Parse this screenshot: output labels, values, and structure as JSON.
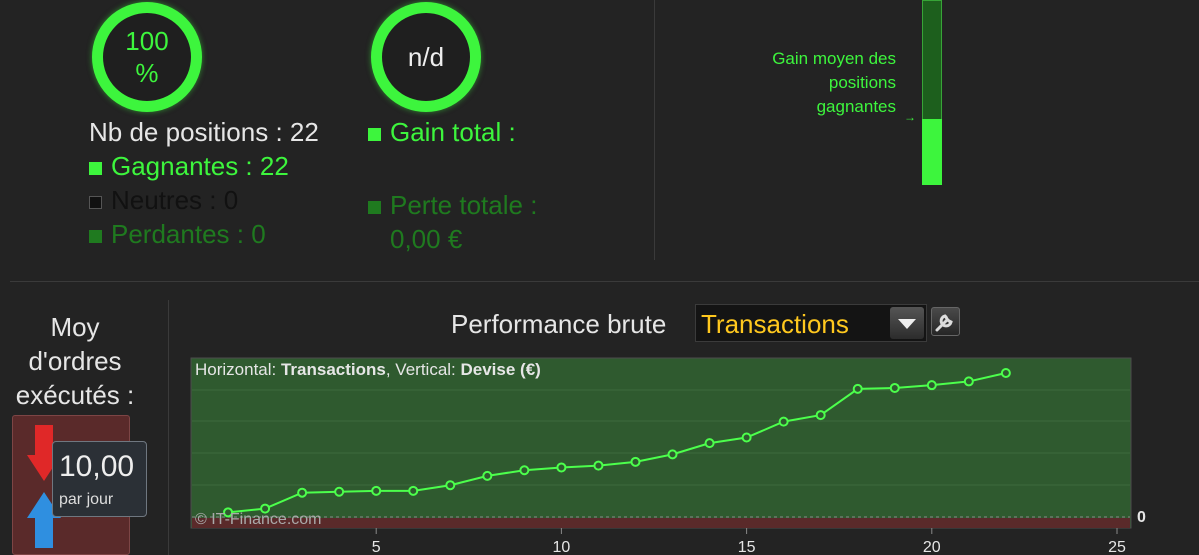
{
  "rings": {
    "left_text": "100\n%",
    "right_text": "n/d"
  },
  "stats_left": {
    "positions": "Nb de positions : 22",
    "gagnantes": "Gagnantes : 22",
    "neutres": "Neutres : 0",
    "perdantes": "Perdantes : 0"
  },
  "stats_right": {
    "gain_total": "Gain total :",
    "perte_totale": "Perte totale :",
    "perte_value": "0,00 €"
  },
  "gain_moyen": {
    "label_line1": "Gain moyen des",
    "label_line2": "positions",
    "label_line3": "gagnantes",
    "arrow": "→",
    "fill_fraction": 0.36
  },
  "orders": {
    "title_line1": "Moy",
    "title_line2": "d'ordres",
    "title_line3": "exécutés :",
    "value": "10,00",
    "unit": "par jour"
  },
  "perf": {
    "title": "Performance brute",
    "select_value": "Transactions"
  },
  "colors": {
    "accent": "#3df53d",
    "dim_green": "#1f7a1f",
    "gold": "#ffc81e",
    "plot_bg": "#2f5a2f"
  },
  "chart_data": {
    "type": "line",
    "subtitle_prefix_h": "Horizontal: ",
    "subtitle_bold_h": "Transactions",
    "subtitle_prefix_v": ", Vertical: ",
    "subtitle_bold_v": "Devise (€)",
    "watermark": "© IT-Finance.com",
    "x_ticks": [
      5,
      10,
      15,
      20,
      25
    ],
    "y_tick_label": "0",
    "xlim": [
      0,
      25
    ],
    "ylim": [
      -1,
      16
    ],
    "x": [
      1,
      2,
      3,
      4,
      5,
      6,
      7,
      8,
      9,
      10,
      11,
      12,
      13,
      14,
      15,
      16,
      17,
      18,
      19,
      20,
      21,
      22
    ],
    "y": [
      0.5,
      0.9,
      2.6,
      2.7,
      2.8,
      2.8,
      3.4,
      4.4,
      5.0,
      5.3,
      5.5,
      5.9,
      6.7,
      7.9,
      8.5,
      10.2,
      10.9,
      13.7,
      13.8,
      14.1,
      14.5,
      15.4
    ]
  }
}
